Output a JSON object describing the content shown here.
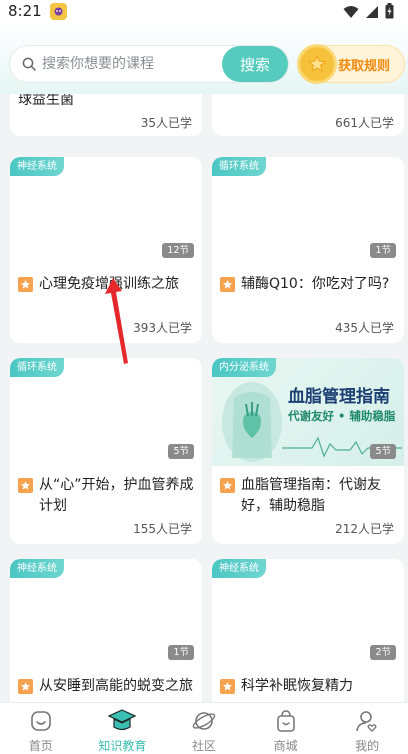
{
  "status_bar": {
    "time": "8:21"
  },
  "search": {
    "placeholder": "搜索你想要的课程",
    "button_label": "搜索"
  },
  "rules": {
    "label": "获取规则"
  },
  "courses": [
    {
      "tag": "",
      "lessons": "",
      "title": "球益生菌",
      "learners": "35人已学",
      "starred": false
    },
    {
      "tag": "",
      "lessons": "",
      "title": "",
      "learners": "661人已学",
      "starred": false
    },
    {
      "tag": "神经系统",
      "lessons": "12节",
      "title": "心理免疫增强训练之旅",
      "learners": "393人已学",
      "starred": true
    },
    {
      "tag": "循环系统",
      "lessons": "1节",
      "title": "辅酶Q10：你吃对了吗?",
      "learners": "435人已学",
      "starred": true
    },
    {
      "tag": "循环系统",
      "lessons": "5节",
      "title": "从“心”开始，护血管养成计划",
      "learners": "155人已学",
      "starred": true
    },
    {
      "tag": "内分泌系统",
      "lessons": "5节",
      "title": "血脂管理指南：代谢友好，辅助稳脂",
      "learners": "212人已学",
      "starred": true,
      "promo": {
        "title": "血脂管理指南",
        "subtitle": "代谢友好 • 辅助稳脂"
      }
    },
    {
      "tag": "神经系统",
      "lessons": "1节",
      "title": "从安睡到高能的蜕变之旅",
      "learners": "",
      "starred": true
    },
    {
      "tag": "神经系统",
      "lessons": "2节",
      "title": "科学补眠恢复精力",
      "learners": "",
      "starred": true
    }
  ],
  "tabbar": {
    "items": [
      {
        "label": "首页",
        "icon": "home-icon",
        "active": false
      },
      {
        "label": "知识教育",
        "icon": "graduation-cap-icon",
        "active": true
      },
      {
        "label": "社区",
        "icon": "planet-icon",
        "active": false
      },
      {
        "label": "商城",
        "icon": "shopping-bag-icon",
        "active": false
      },
      {
        "label": "我的",
        "icon": "user-heart-icon",
        "active": false
      }
    ]
  },
  "colors": {
    "accent": "#55cbbe",
    "tab_active": "#3bbfb2",
    "rules_text": "#f08a0c",
    "star_badge": "#f7a24f"
  }
}
